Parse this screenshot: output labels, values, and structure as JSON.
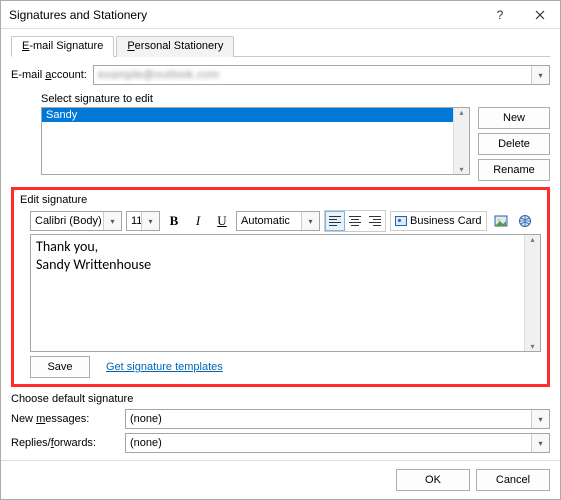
{
  "title": "Signatures and Stationery",
  "tabs": {
    "email": "E-mail Signature",
    "personal": "Personal Stationery"
  },
  "account": {
    "label": "E-mail account:",
    "value": "example@outlook.com"
  },
  "select_sig_label": "Select signature to edit",
  "selected_signature": "Sandy",
  "side_buttons": {
    "new": "New",
    "delete": "Delete",
    "rename": "Rename"
  },
  "edit_sig_label": "Edit signature",
  "toolbar": {
    "font": "Calibri (Body)",
    "size": "11",
    "color": "Automatic",
    "biz": "Business Card"
  },
  "signature_body": "Thank you,\nSandy Writtenhouse",
  "save_label": "Save",
  "templates_link": "Get signature templates",
  "defaults": {
    "heading": "Choose default signature",
    "new_label": "New messages:",
    "new_value": "(none)",
    "reply_label": "Replies/forwards:",
    "reply_value": "(none)"
  },
  "footer": {
    "ok": "OK",
    "cancel": "Cancel"
  }
}
